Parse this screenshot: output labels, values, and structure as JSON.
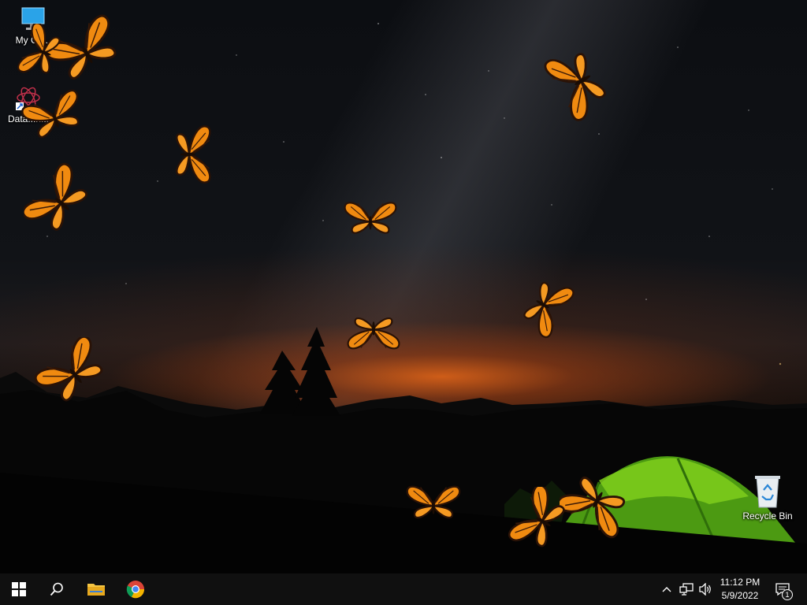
{
  "desktop": {
    "icons": [
      {
        "name": "my-computer",
        "label": "My Co..."
      },
      {
        "name": "data-shortcut",
        "label": "Data...n..."
      },
      {
        "name": "recycle-bin",
        "label": "Recycle Bin"
      }
    ]
  },
  "taskbar": {
    "apps": [
      {
        "name": "start",
        "icon": "windows-logo-icon"
      },
      {
        "name": "search",
        "icon": "search-icon"
      },
      {
        "name": "file-explorer",
        "icon": "folder-icon"
      },
      {
        "name": "chrome",
        "icon": "chrome-icon"
      }
    ],
    "tray": {
      "time": "11:12 PM",
      "date": "5/9/2022",
      "notification_count": "1"
    }
  }
}
